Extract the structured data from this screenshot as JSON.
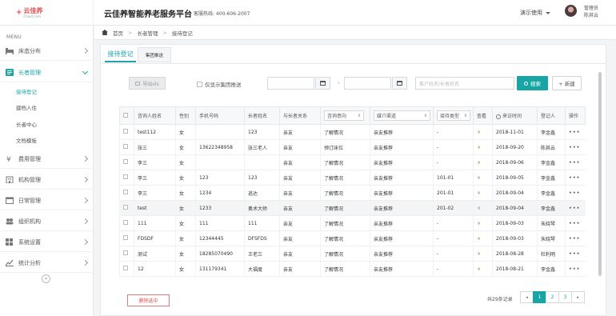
{
  "brand": {
    "mark": "+",
    "name_cn": "云佳养",
    "name_en": "Cloud care"
  },
  "header": {
    "title": "云佳养智能养老服务平台",
    "hotline": "客服热线: 400-606-2007",
    "demo_menu": "演示使用",
    "user_role": "管理员",
    "user_name": "陈其云"
  },
  "sidebar": {
    "caption": "MENU",
    "items": [
      {
        "label": "床态分布",
        "icon": "bed-icon"
      },
      {
        "label": "长者管理",
        "icon": "elder-icon",
        "open": true
      },
      {
        "label": "费用管理",
        "icon": "yen-icon"
      },
      {
        "label": "机构管理",
        "icon": "building-icon"
      },
      {
        "label": "日常管理",
        "icon": "calendar-icon"
      },
      {
        "label": "组织机构",
        "icon": "org-icon"
      },
      {
        "label": "系统设置",
        "icon": "settings-icon"
      },
      {
        "label": "统计分析",
        "icon": "chart-icon"
      }
    ],
    "sub_items": [
      "接待登记",
      "建档入住",
      "长者中心",
      "文档模板"
    ],
    "collapse_glyph": "«"
  },
  "breadcrumb": {
    "home": "首页",
    "section": "长者管理",
    "page": "接待登记",
    "sep": ">"
  },
  "tabs": [
    "接待登记",
    "集团推送"
  ],
  "toolbar": {
    "export": "导出xls",
    "group_only": "仅显示集团推送",
    "date_sep": "-",
    "search_placeholder": "客户姓名/长者姓名",
    "search": "搜索",
    "new": "+ 新建"
  },
  "table": {
    "headers": [
      "咨询人姓名",
      "性别",
      "手机号码",
      "长者姓名",
      "与长者关系",
      "咨询意向",
      "媒介渠道",
      "接待类型",
      "查看",
      "来访时间",
      "登记人",
      "操作"
    ],
    "filter_arrow": "⇕",
    "view_glyph": "»",
    "more_glyph": "•••",
    "rows": [
      {
        "name": "test112",
        "gender": "女",
        "phone": "",
        "elder": "123",
        "rel": "亲友",
        "intent": "了解情况",
        "channel": "亲友推荐",
        "type": "-",
        "date": "2018-11-01",
        "registrar": "李金鑫"
      },
      {
        "name": "张三",
        "gender": "女",
        "phone": "13622348958",
        "elder": "张三老人",
        "rel": "亲友",
        "intent": "预订床位",
        "channel": "亲友推荐",
        "type": "-",
        "date": "2018-09-20",
        "registrar": "陈其云"
      },
      {
        "name": "李三",
        "gender": "女",
        "phone": "",
        "elder": "",
        "rel": "亲友",
        "intent": "了解情况",
        "channel": "亲友推荐",
        "type": "-",
        "date": "2018-09-06",
        "registrar": "李金鑫"
      },
      {
        "name": "李三",
        "gender": "女",
        "phone": "123",
        "elder": "123",
        "rel": "亲友",
        "intent": "了解情况",
        "channel": "亲友推荐",
        "type": "101-01",
        "date": "2018-09-05",
        "registrar": "李金鑫"
      },
      {
        "name": "李三",
        "gender": "女",
        "phone": "1234",
        "elder": "逃达",
        "rel": "亲友",
        "intent": "了解情况",
        "channel": "亲友推荐",
        "type": "201-01",
        "date": "2018-09-04",
        "registrar": "李金鑫"
      },
      {
        "name": "test",
        "gender": "女",
        "phone": "1233",
        "elder": "奥术大师",
        "rel": "亲友",
        "intent": "了解情况",
        "channel": "亲友推荐",
        "type": "201-02",
        "date": "2018-09-04",
        "registrar": "李金鑫"
      },
      {
        "name": "111",
        "gender": "女",
        "phone": "111",
        "elder": "111",
        "rel": "亲友",
        "intent": "了解情况",
        "channel": "亲友推荐",
        "type": "-",
        "date": "2018-09-03",
        "registrar": "朱晓琴"
      },
      {
        "name": "FDSDF",
        "gender": "女",
        "phone": "12344445",
        "elder": "DFSFDS",
        "rel": "亲友",
        "intent": "了解情况",
        "channel": "亲友推荐",
        "type": "-",
        "date": "2018-09-03",
        "registrar": "朱晓琴"
      },
      {
        "name": "测试",
        "gender": "女",
        "phone": "18285070490",
        "elder": "王老三",
        "rel": "亲友",
        "intent": "了解情况",
        "channel": "亲友推荐",
        "type": "-",
        "date": "2018-08-28",
        "registrar": "杜利明"
      },
      {
        "name": "12",
        "gender": "女",
        "phone": "131179341",
        "elder": "大福度",
        "rel": "亲友",
        "intent": "了解情况",
        "channel": "亲友推荐",
        "type": "-",
        "date": "2018-08-21",
        "registrar": "李金鑫"
      }
    ]
  },
  "footer": {
    "delete": "删除选中",
    "total": "共29条记录",
    "pages": [
      "1",
      "2",
      "3"
    ],
    "prev": "◂",
    "next": "▸"
  },
  "colors": {
    "accent": "#17a6a5",
    "danger": "#d9534f",
    "brand": "#e24a4a"
  }
}
